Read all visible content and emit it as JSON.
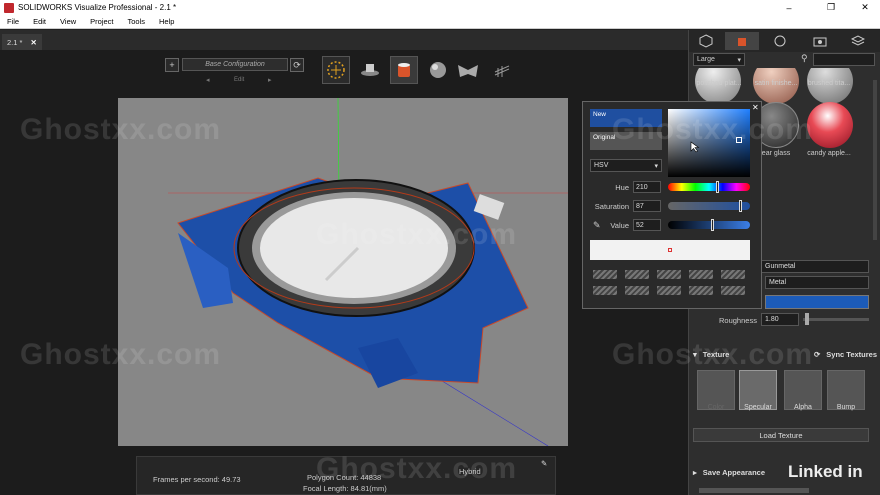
{
  "window": {
    "title": "SOLIDWORKS Visualize Professional - 2.1 *",
    "minimize": "–",
    "restore": "❐",
    "close": "✕"
  },
  "menu": [
    "File",
    "Edit",
    "View",
    "Project",
    "Tools",
    "Help"
  ],
  "doc_tab": {
    "label": "2.1 *",
    "close": "✕"
  },
  "toolbar": {
    "add": "+",
    "config": "Base Configuration",
    "sync": "⟳",
    "edit": "Edit",
    "prev": "◂",
    "next": "▸"
  },
  "stats": {
    "fps": "Frames per second: 49.73",
    "polygons": "Polygon Count: 44838",
    "focal": "Focal Length: 84.81(mm)",
    "mode": "Hybrid"
  },
  "right_panel": {
    "size_select": "Large",
    "size_arrow": "▾",
    "materials": [
      {
        "label": "polished plat..."
      },
      {
        "label": "satin finishe..."
      },
      {
        "label": "brushed tita..."
      },
      {
        "label": "ear glass"
      },
      {
        "label": "candy apple..."
      }
    ],
    "appearance_name": "Gunmetal",
    "appearance_type": "Metal",
    "roughness_label": "Roughness",
    "roughness_value": "1.80",
    "texture_section": "Texture",
    "sync_textures": "Sync Textures",
    "texture_slots": [
      "Color",
      "Specular",
      "Alpha",
      "Bump"
    ],
    "load_texture": "Load Texture",
    "save_appearance": "Save Appearance"
  },
  "color_picker": {
    "new_label": "New",
    "original_label": "Original",
    "mode": "HSV",
    "mode_arrow": "▾",
    "hue_label": "Hue",
    "hue": "210",
    "saturation_label": "Saturation",
    "saturation": "87",
    "value_label": "Value",
    "value": "52",
    "close": "✕",
    "hue_fraction": 0.58,
    "saturation_fraction": 0.87,
    "value_fraction": 0.52
  },
  "watermarks": [
    "Ghostxx.com",
    "Ghostxx.com",
    "Ghostxx.com",
    "Ghostxx.com",
    "Ghostxx.com",
    "Ghostxx.com",
    "Ghostxx.com"
  ],
  "brand": "Linked in",
  "colors": {
    "new_swatch": "#1f4fa0",
    "original_swatch": "#555555",
    "appearance_color": "#1c5bb8"
  }
}
